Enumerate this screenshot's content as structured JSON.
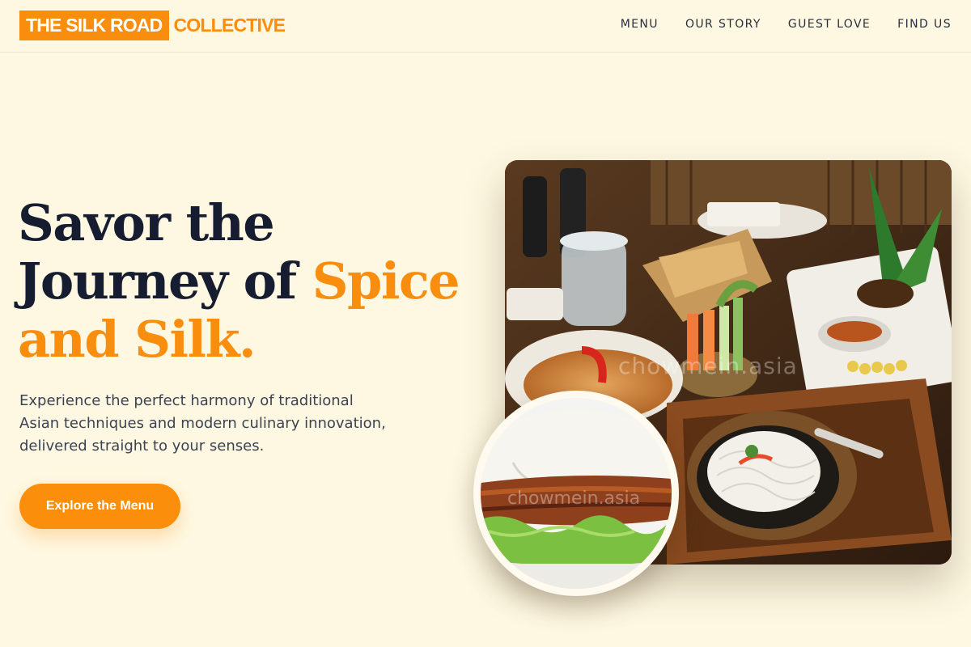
{
  "brand": {
    "logo_box": "THE SILK ROAD",
    "logo_rest": "COLLECTIVE",
    "accent_color": "#f98d0e"
  },
  "nav": {
    "items": [
      {
        "label": "MENU"
      },
      {
        "label": "OUR STORY"
      },
      {
        "label": "GUEST LOVE"
      },
      {
        "label": "FIND US"
      }
    ]
  },
  "hero": {
    "title_line1": "Savor the",
    "title_line2a": "Journey of ",
    "title_line2b": "Spice",
    "title_line3": "and Silk.",
    "subtitle": "Experience the perfect harmony of traditional Asian techniques and modern culinary innovation, delivered straight to your senses.",
    "cta_label": "Explore the Menu"
  },
  "images": {
    "main_photo_watermark": "chowmein.asia",
    "inset_photo_watermark": "chowmein.asia",
    "main_photo_alt": "table-of-asian-dishes-photo",
    "inset_photo_alt": "sandwich-closeup-photo"
  }
}
